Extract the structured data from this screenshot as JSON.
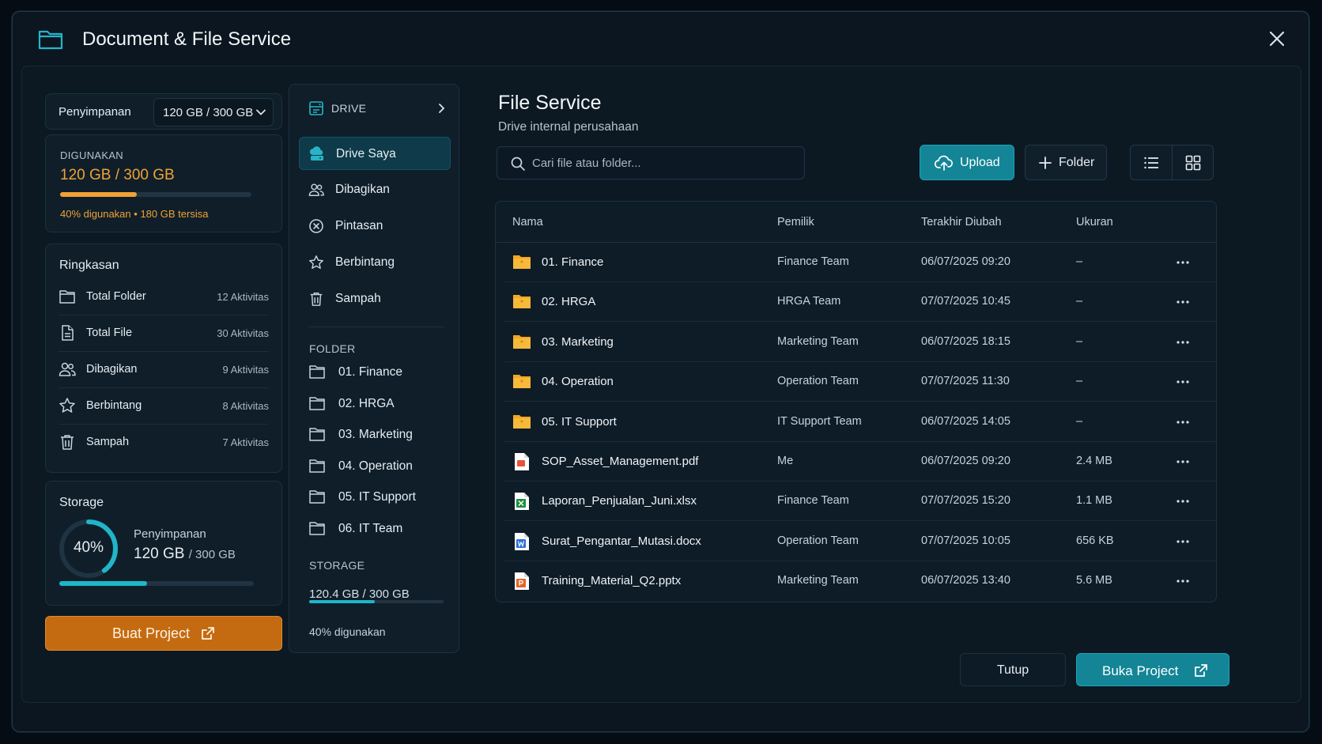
{
  "window": {
    "title": "Document & File Service"
  },
  "left": {
    "storage_select": {
      "label": "Penyimpanan",
      "value": "120 GB / 300 GB"
    },
    "used": {
      "label": "DIGUNAKAN",
      "value": "120 GB / 300 GB",
      "percent": 40,
      "foot_used": "40% digunakan",
      "foot_sep": "•",
      "foot_free": "180 GB tersisa"
    },
    "summary": {
      "title": "Ringkasan",
      "items": [
        {
          "name": "Total Folder",
          "count": "12 Aktivitas",
          "icon": "folder-icon"
        },
        {
          "name": "Total File",
          "count": "30 Aktivitas",
          "icon": "file-icon"
        },
        {
          "name": "Dibagikan",
          "count": "9 Aktivitas",
          "icon": "users-icon"
        },
        {
          "name": "Berbintang",
          "count": "8 Aktivitas",
          "icon": "star-icon"
        },
        {
          "name": "Sampah",
          "count": "7 Aktivitas",
          "icon": "trash-icon"
        }
      ]
    },
    "storage": {
      "title": "Storage",
      "percent_label": "40%",
      "percent": 40,
      "label": "Penyimpanan",
      "value": "120 GB",
      "total": "/ 300 GB"
    },
    "create_project": "Buat Project"
  },
  "nav": {
    "drive_label": "DRIVE",
    "items": [
      {
        "label": "Drive Saya",
        "icon": "drive-icon",
        "active": true
      },
      {
        "label": "Dibagikan",
        "icon": "users-icon",
        "active": false
      },
      {
        "label": "Pintasan",
        "icon": "shortcut-icon",
        "active": false
      },
      {
        "label": "Berbintang",
        "icon": "star-icon",
        "active": false
      },
      {
        "label": "Sampah",
        "icon": "trash-icon",
        "active": false
      }
    ],
    "folder_label": "FOLDER",
    "folders": [
      "01. Finance",
      "02. HRGA",
      "03. Marketing",
      "04. Operation",
      "05. IT Support",
      "06. IT Team"
    ],
    "storage_label": "STORAGE",
    "storage_value": "120.4 GB / 300 GB",
    "storage_percent": 40,
    "storage_foot": "40% digunakan"
  },
  "main": {
    "title": "File Service",
    "subtitle": "Drive internal perusahaan",
    "search_placeholder": "Cari file atau folder...",
    "upload": "Upload",
    "new_folder": "Folder",
    "columns": {
      "name": "Nama",
      "owner": "Pemilik",
      "modified": "Terakhir Diubah",
      "size": "Ukuran"
    },
    "rows": [
      {
        "name": "01. Finance",
        "type": "folder",
        "owner": "Finance Team",
        "modified": "06/07/2025 09:20",
        "size": "–"
      },
      {
        "name": "02. HRGA",
        "type": "folder",
        "owner": "HRGA Team",
        "modified": "07/07/2025 10:45",
        "size": "–"
      },
      {
        "name": "03. Marketing",
        "type": "folder",
        "owner": "Marketing Team",
        "modified": "06/07/2025 18:15",
        "size": "–"
      },
      {
        "name": "04. Operation",
        "type": "folder",
        "owner": "Operation Team",
        "modified": "07/07/2025 11:30",
        "size": "–"
      },
      {
        "name": "05. IT Support",
        "type": "folder",
        "owner": "IT Support Team",
        "modified": "06/07/2025 14:05",
        "size": "–"
      },
      {
        "name": "SOP_Asset_Management.pdf",
        "type": "pdf",
        "owner": "Me",
        "modified": "06/07/2025 09:20",
        "size": "2.4 MB"
      },
      {
        "name": "Laporan_Penjualan_Juni.xlsx",
        "type": "xlsx",
        "owner": "Finance Team",
        "modified": "07/07/2025 15:20",
        "size": "1.1 MB"
      },
      {
        "name": "Surat_Pengantar_Mutasi.docx",
        "type": "docx",
        "owner": "Operation Team",
        "modified": "07/07/2025 10:05",
        "size": "656 KB"
      },
      {
        "name": "Training_Material_Q2.pptx",
        "type": "pptx",
        "owner": "Marketing Team",
        "modified": "06/07/2025 13:40",
        "size": "5.6 MB"
      }
    ]
  },
  "footer": {
    "close": "Tutup",
    "open": "Buka Project"
  },
  "colors": {
    "accent": "#1aa5b8",
    "orange": "#f0a235",
    "folder": "#f5a623",
    "pdf": "#e5533d",
    "xlsx": "#1e8e3e",
    "docx": "#2b6fd6",
    "pptx": "#e0662c"
  }
}
